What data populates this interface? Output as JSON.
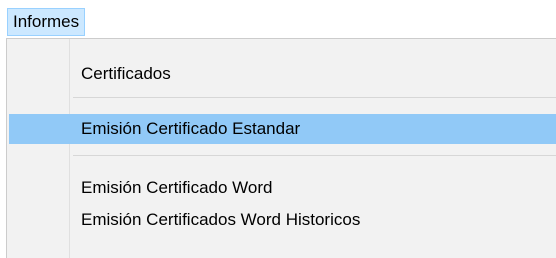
{
  "menubar": {
    "items": [
      {
        "label": "Informes"
      }
    ]
  },
  "dropdown": {
    "items": [
      {
        "label": "Certificados"
      },
      {
        "label": "Emisión Certificado Estandar"
      },
      {
        "label": "Emisión Certificado Word"
      },
      {
        "label": "Emisión Certificados Word Historicos"
      }
    ]
  }
}
